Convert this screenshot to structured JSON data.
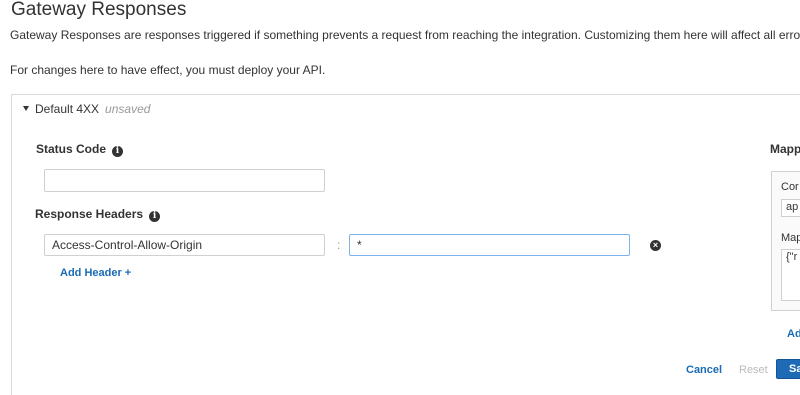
{
  "header": {
    "title": "Gateway Responses",
    "intro": "Gateway Responses are responses triggered if something prevents a request from reaching the integration. Customizing them here will affect all errors of th",
    "deploy_note": "For changes here to have effect, you must deploy your API."
  },
  "section": {
    "title": "Default 4XX",
    "state": "unsaved"
  },
  "status_code": {
    "label": "Status Code",
    "value": ""
  },
  "response_headers": {
    "label": "Response Headers",
    "rows": [
      {
        "name": "Access-Control-Allow-Origin",
        "separator": ":",
        "value": "*"
      }
    ],
    "add_label": "Add Header +"
  },
  "mapping": {
    "label": "Mapp",
    "content_type_label": "Cor",
    "content_type_value": "ap",
    "template_label": "Map",
    "template_value": "{\"r",
    "add_label": "Ad"
  },
  "footer": {
    "cancel": "Cancel",
    "reset": "Reset",
    "save": "Sa"
  },
  "colors": {
    "link": "#1a6bb5",
    "primary": "#1f6ab6",
    "focus_border": "#7eb3ec"
  }
}
